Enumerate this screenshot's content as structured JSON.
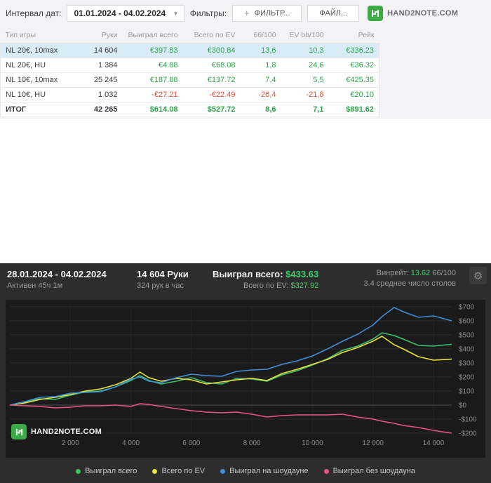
{
  "icons": {
    "caret_down": "▾",
    "plus": "+",
    "gear": "⚙"
  },
  "brand": {
    "text": "HAND2NOTE.COM"
  },
  "toolbar": {
    "date_label": "Интервал дат:",
    "date_value": "01.01.2024 - 04.02.2024",
    "filters_label": "Фильтры:",
    "filter_button": "ФИЛЬТР...",
    "file_button": "ФАЙЛ..."
  },
  "table": {
    "columns": [
      "Тип игры",
      "Руки",
      "Выиграл всего",
      "Всего по EV",
      "66/100",
      "EV bb/100",
      "Рейк"
    ],
    "rows": [
      {
        "cells": [
          "NL 20€, 10max",
          "14 604",
          "€397.83",
          "€300.84",
          "13,6",
          "10,3",
          "€336.23"
        ],
        "highlight": true,
        "total": false
      },
      {
        "cells": [
          "NL 20€, HU",
          "1 384",
          "€4.88",
          "€68.08",
          "1,8",
          "24,6",
          "€36.32"
        ],
        "highlight": false,
        "total": false
      },
      {
        "cells": [
          "NL 10€, 10max",
          "25 245",
          "€187.88",
          "€137.72",
          "7,4",
          "5,5",
          "€425.35"
        ],
        "highlight": false,
        "total": false
      },
      {
        "cells": [
          "NL 10€, HU",
          "1 032",
          "-€27.21",
          "-€22.49",
          "-26,4",
          "-21,8",
          "€20.10"
        ],
        "highlight": false,
        "total": false
      },
      {
        "cells": [
          "ИТОГ",
          "42 265",
          "$614.08",
          "$527.72",
          "8,6",
          "7,1",
          "$891.62"
        ],
        "highlight": false,
        "total": true
      }
    ]
  },
  "panel": {
    "date_range": "28.01.2024 - 04.02.2024",
    "active_time": "Активен 45ч 1м",
    "hands": "14 604 Руки",
    "hands_per_hour": "324 рук в час",
    "won_label": "Выиграл всего:",
    "won_value": "$433.63",
    "ev_label": "Всего по EV:",
    "ev_value": "$327.92",
    "winrate_label": "Винрейт:",
    "winrate_value": "13.62",
    "winrate_suffix": "66/100",
    "tables_avg": "3.4 среднее число столов"
  },
  "chart_data": {
    "type": "line",
    "xlim": [
      0,
      14604
    ],
    "ylim": [
      -200,
      700
    ],
    "grid": true,
    "legend_position": "bottom",
    "y_ticks": [
      {
        "value": 700,
        "label": "$700"
      },
      {
        "value": 600,
        "label": "$600"
      },
      {
        "value": 500,
        "label": "$500"
      },
      {
        "value": 400,
        "label": "$400"
      },
      {
        "value": 300,
        "label": "$300"
      },
      {
        "value": 200,
        "label": "$200"
      },
      {
        "value": 100,
        "label": "$100"
      },
      {
        "value": 0,
        "label": "$0"
      },
      {
        "value": -100,
        "label": "-$100"
      },
      {
        "value": -200,
        "label": "-$200"
      }
    ],
    "x_ticks": [
      {
        "value": 2000,
        "label": "2 000"
      },
      {
        "value": 4000,
        "label": "4 000"
      },
      {
        "value": 6000,
        "label": "6 000"
      },
      {
        "value": 8000,
        "label": "8 000"
      },
      {
        "value": 10000,
        "label": "10 000"
      },
      {
        "value": 12000,
        "label": "12 000"
      },
      {
        "value": 14000,
        "label": "14 000"
      }
    ],
    "x": [
      0,
      500,
      1000,
      1500,
      2000,
      2500,
      3000,
      3500,
      4000,
      4300,
      4600,
      5000,
      5500,
      6000,
      6500,
      7000,
      7500,
      8000,
      8500,
      9000,
      9500,
      10000,
      10500,
      11000,
      11500,
      12000,
      12300,
      12700,
      13000,
      13500,
      14000,
      14604
    ],
    "series": [
      {
        "name": "Выиграл всего",
        "color": "#3fbf6f",
        "y": [
          0,
          20,
          45,
          40,
          70,
          95,
          100,
          130,
          175,
          210,
          175,
          150,
          170,
          195,
          160,
          150,
          190,
          185,
          170,
          215,
          245,
          285,
          330,
          390,
          420,
          470,
          515,
          495,
          470,
          425,
          420,
          433
        ]
      },
      {
        "name": "Всего по EV",
        "color": "#e8e33b",
        "y": [
          0,
          15,
          40,
          55,
          75,
          100,
          115,
          145,
          190,
          235,
          195,
          170,
          190,
          180,
          150,
          165,
          180,
          190,
          175,
          225,
          255,
          290,
          325,
          375,
          410,
          455,
          490,
          430,
          400,
          345,
          320,
          327
        ]
      },
      {
        "name": "Выиграл на шоудауне",
        "color": "#3f8fd8",
        "y": [
          0,
          25,
          55,
          60,
          85,
          90,
          95,
          130,
          185,
          200,
          170,
          160,
          195,
          220,
          210,
          205,
          240,
          250,
          255,
          290,
          315,
          350,
          400,
          455,
          505,
          570,
          630,
          695,
          665,
          625,
          635,
          600
        ]
      },
      {
        "name": "Выиграл без шоудауна",
        "color": "#e85585",
        "y": [
          0,
          -5,
          -10,
          -20,
          -15,
          -5,
          -5,
          0,
          -10,
          10,
          5,
          -10,
          -25,
          -40,
          -50,
          -55,
          -50,
          -65,
          -85,
          -75,
          -70,
          -70,
          -70,
          -65,
          -85,
          -100,
          -115,
          -130,
          -145,
          -160,
          -180,
          -200
        ]
      }
    ]
  }
}
